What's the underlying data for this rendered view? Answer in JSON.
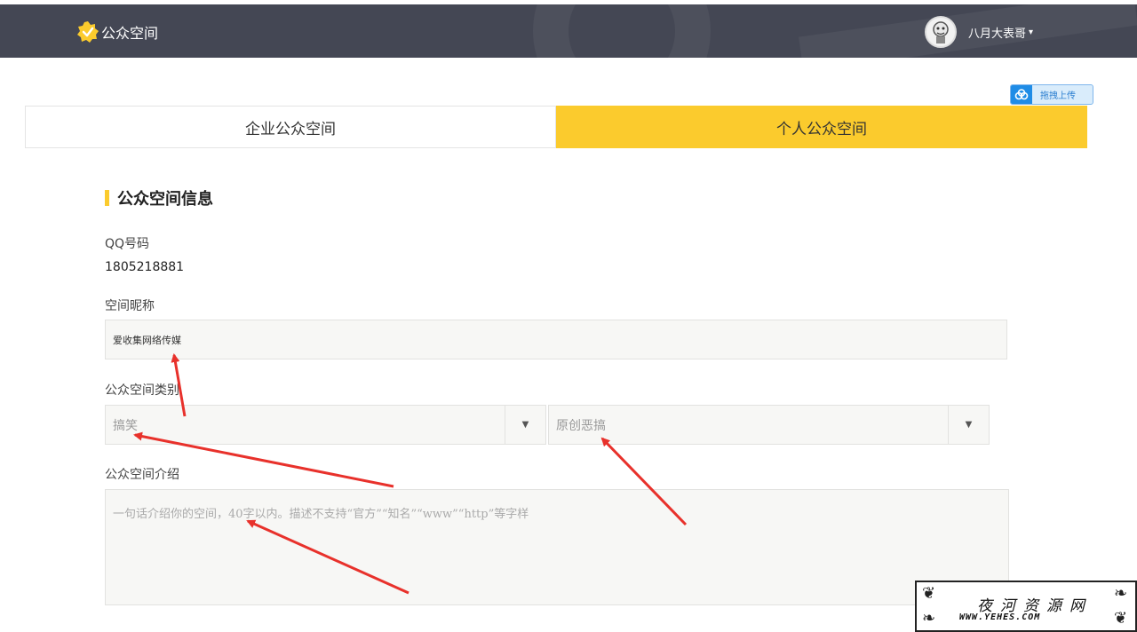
{
  "header": {
    "logo_text": "公众空间",
    "username": "八月大表哥",
    "caret": "▾"
  },
  "upload": {
    "label": "拖拽上传"
  },
  "tabs": [
    {
      "label": "企业公众空间",
      "active": false
    },
    {
      "label": "个人公众空间",
      "active": true
    }
  ],
  "section": {
    "title": "公众空间信息"
  },
  "form": {
    "qq_label": "QQ号码",
    "qq_value": "1805218881",
    "nickname_label": "空间昵称",
    "nickname_value": "爱收集网络传媒",
    "category_label": "公众空间类别",
    "category_primary": "搞笑",
    "category_secondary": "原创恶搞",
    "intro_label": "公众空间介绍",
    "intro_placeholder": "一句话介绍你的空间，40字以内。描述不支持“官方”“知名”“www”“http”等字样"
  },
  "watermark": {
    "name": "夜河资源网",
    "url": "WWW.YEHES.COM"
  },
  "colors": {
    "header_bg": "#444754",
    "accent_yellow": "#fbcb2d",
    "arrow_red": "#e8312b"
  }
}
